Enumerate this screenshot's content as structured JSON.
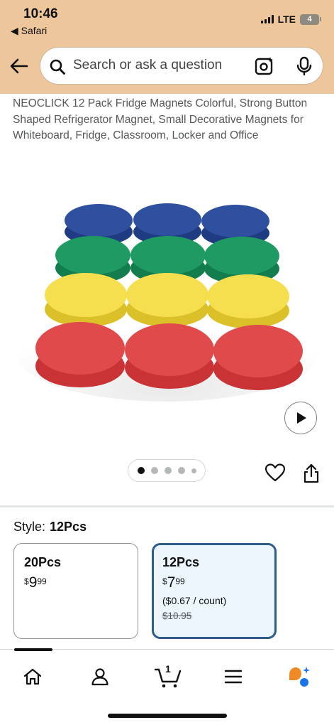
{
  "status_bar": {
    "time": "10:46",
    "back_app": "◀ Safari",
    "network": "LTE",
    "battery": "4"
  },
  "search": {
    "placeholder": "Search or ask a question"
  },
  "product": {
    "title": "NEOCLICK 12 Pack Fridge Magnets Colorful, Strong Button Shaped Refrigerator Magnet, Small Decorative Magnets for Whiteboard, Fridge, Classroom, Locker and Office",
    "image_carousel": {
      "total": 5,
      "active_index": 0
    }
  },
  "style_selector": {
    "label": "Style:",
    "selected": "12Pcs",
    "options": [
      {
        "name": "20Pcs",
        "price_symbol": "$",
        "price_whole": "9",
        "price_fraction": "99"
      },
      {
        "name": "12Pcs",
        "price_symbol": "$",
        "price_whole": "7",
        "price_fraction": "99",
        "unit_price": "($0.67 / count)",
        "list_price": "$10.95"
      }
    ]
  },
  "bottom_nav": {
    "cart_count": "1",
    "items": [
      "home-icon",
      "account-icon",
      "cart-icon",
      "menu-icon",
      "rufus-assistant-icon"
    ]
  },
  "colors": {
    "header_bg": "#edc79b",
    "selected_border": "#2f5d8a",
    "selected_bg": "#edf6fd",
    "magnet_blue": "#2f4f9f",
    "magnet_green": "#1f9a62",
    "magnet_yellow": "#f6df4f",
    "magnet_red": "#e04a4b"
  }
}
